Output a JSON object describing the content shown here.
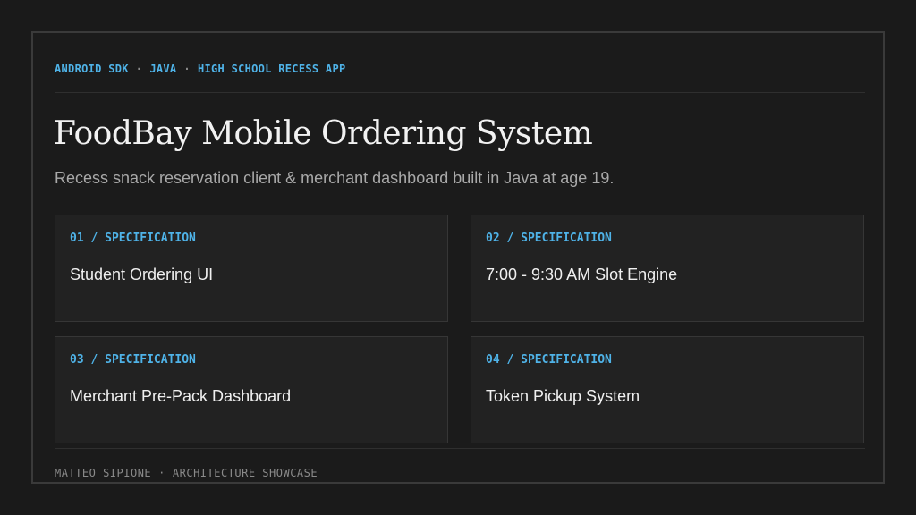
{
  "header": {
    "tags": [
      "ANDROID SDK",
      "JAVA",
      "HIGH SCHOOL RECESS APP"
    ],
    "separator": "·"
  },
  "title": "FoodBay Mobile Ordering System",
  "subtitle": "Recess snack reservation client & merchant dashboard built in Java at age 19.",
  "cards": [
    {
      "label": "01 / SPECIFICATION",
      "text": "Student Ordering UI"
    },
    {
      "label": "02 / SPECIFICATION",
      "text": "7:00 - 9:30 AM Slot Engine"
    },
    {
      "label": "03 / SPECIFICATION",
      "text": "Merchant Pre-Pack Dashboard"
    },
    {
      "label": "04 / SPECIFICATION",
      "text": "Token Pickup System"
    }
  ],
  "footer": {
    "author": "MATTEO SIPIONE",
    "separator": "·",
    "section": "ARCHITECTURE SHOWCASE"
  },
  "colors": {
    "accent": "#4fb3e8",
    "background": "#1a1a1a",
    "card": "#222222"
  }
}
